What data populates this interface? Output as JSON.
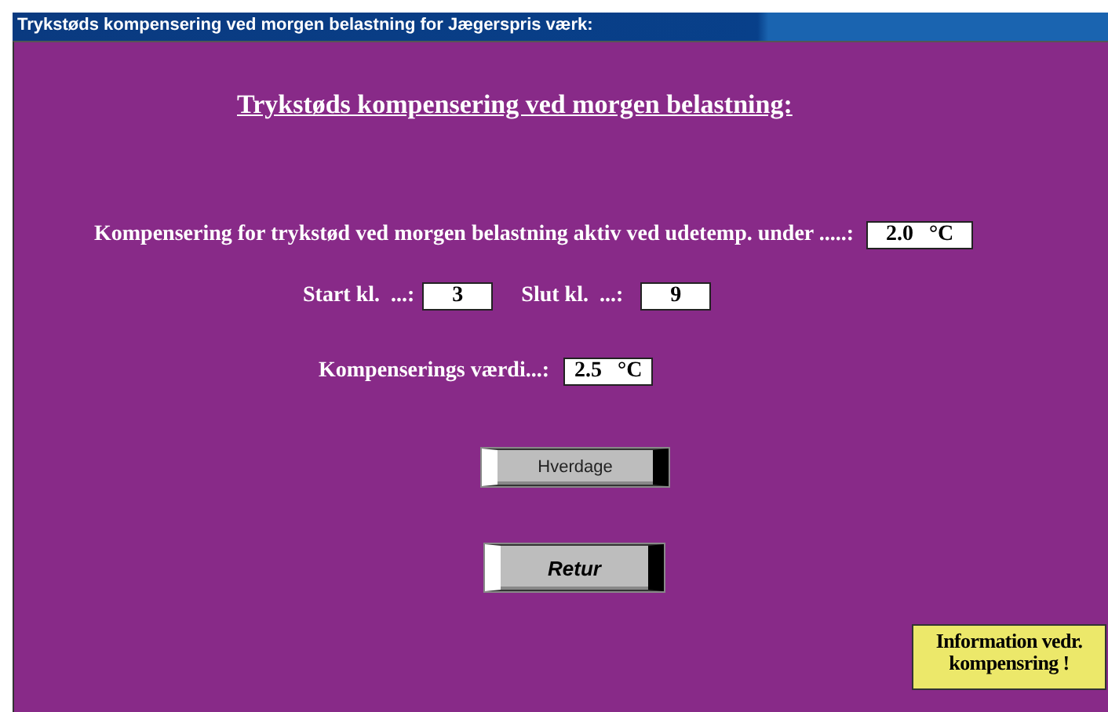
{
  "window": {
    "title": "Trykstøds kompensering ved morgen belastning for Jægerspris værk:"
  },
  "heading": "Trykstøds kompensering ved morgen belastning:",
  "threshold": {
    "label": "Kompensering for trykstød ved morgen belastning aktiv ved udetemp. under .....:",
    "value": "2.0",
    "unit": "°C"
  },
  "start": {
    "label": "Start kl.  ...:",
    "value": "3"
  },
  "end": {
    "label": "Slut kl.  ...:",
    "value": "9"
  },
  "compensation": {
    "label": "Kompenserings værdi...:",
    "value": "2.5",
    "unit": "°C"
  },
  "buttons": [
    {
      "label": "Hverdage",
      "italic": false
    },
    {
      "label": "Retur",
      "italic": true
    }
  ],
  "info_note": "Information vedr. kompensring !"
}
